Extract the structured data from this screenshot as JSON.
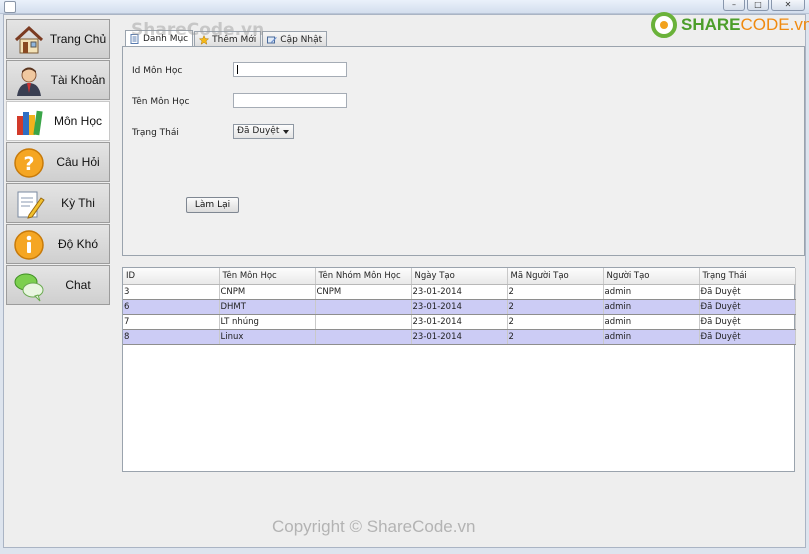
{
  "sidebar": {
    "items": [
      {
        "label": "Trang Chủ",
        "icon": "house-icon"
      },
      {
        "label": "Tài Khoản",
        "icon": "user-icon"
      },
      {
        "label": "Môn Học",
        "icon": "books-icon"
      },
      {
        "label": "Câu Hỏi",
        "icon": "question-icon"
      },
      {
        "label": "Kỳ Thi",
        "icon": "exam-pencil-icon"
      },
      {
        "label": "Độ Khó",
        "icon": "info-icon"
      },
      {
        "label": "Chat",
        "icon": "chat-bubbles-icon"
      }
    ],
    "active": "Môn Học"
  },
  "tabs": [
    {
      "label": "Danh Mục",
      "icon": "list-doc-icon"
    },
    {
      "label": "Thêm Mới",
      "icon": "star-icon"
    },
    {
      "label": "Cập Nhật",
      "icon": "edit-icon"
    }
  ],
  "form": {
    "id_label": "Id Môn Học",
    "id_value": "",
    "name_label": "Tên Môn Học",
    "name_value": "",
    "status_label": "Trạng Thái",
    "status_value": "Đã Duyệt",
    "reset_button": "Làm Lại"
  },
  "table": {
    "columns": [
      "ID",
      "Tên Môn Học",
      "Tên Nhóm Môn Học",
      "Ngày Tạo",
      "Mã Người Tạo",
      "Người Tạo",
      "Trạng Thái"
    ],
    "rows": [
      [
        "3",
        "CNPM",
        "CNPM",
        "23-01-2014",
        "2",
        "admin",
        "Đã Duyệt"
      ],
      [
        "6",
        "DHMT",
        "",
        "23-01-2014",
        "2",
        "admin",
        "Đã Duyệt"
      ],
      [
        "7",
        "LT nhúng",
        "",
        "23-01-2014",
        "2",
        "admin",
        "Đã Duyệt"
      ],
      [
        "8",
        "Linux",
        "",
        "23-01-2014",
        "2",
        "admin",
        "Đã Duyệt"
      ]
    ]
  },
  "watermark": {
    "top": "ShareCode.vn",
    "copyright": "Copyright © ShareCode.vn",
    "logo_share": "SHARE",
    "logo_code": "CODE.vn"
  },
  "window_buttons": {
    "minimize": "–",
    "maximize": "□",
    "close": "✕"
  },
  "colors": {
    "selected_row": "#ccccf5",
    "logo_green": "#4c9e2a",
    "logo_orange": "#f08a10"
  }
}
